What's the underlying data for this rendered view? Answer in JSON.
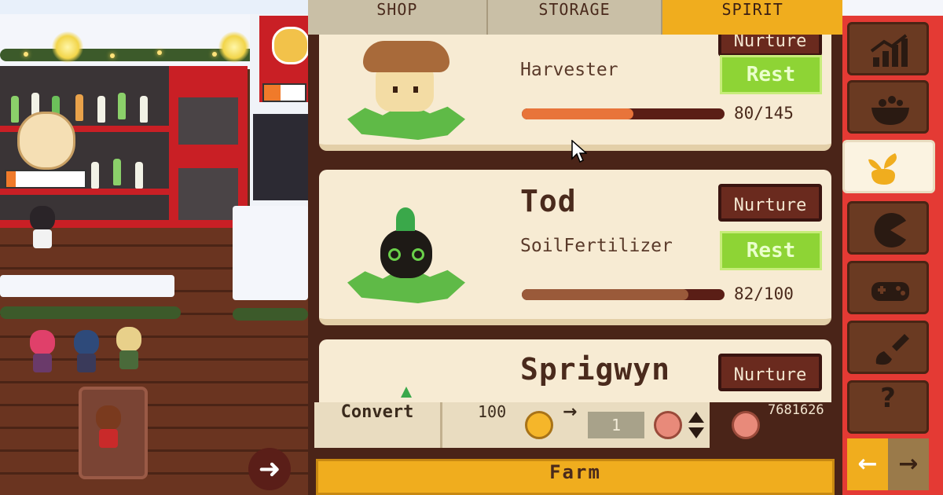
{
  "tabs": [
    {
      "label": "SHOP"
    },
    {
      "label": "STORAGE"
    },
    {
      "label": "SPIRIT"
    }
  ],
  "active_tab": "SPIRIT",
  "spirits": [
    {
      "name": "",
      "role": "Harvester",
      "nurture_label": "Nurture",
      "rest_label": "Rest",
      "progress_text": "80/145",
      "progress": 0.55,
      "bar_color": "#e8743a"
    },
    {
      "name": "Tod",
      "role": "SoilFertilizer",
      "nurture_label": "Nurture",
      "rest_label": "Rest",
      "progress_text": "82/100",
      "progress": 0.82,
      "bar_color": "#9a5a3a"
    },
    {
      "name": "Sprigwyn",
      "nurture_label": "Nurture"
    }
  ],
  "convert": {
    "label": "Convert",
    "coin_amount": "100",
    "arrow": "→",
    "quantity": "1",
    "balance": "7681626"
  },
  "farm_button": {
    "label": "Farm"
  },
  "side_menu": [
    {
      "icon": "stats-chart-icon"
    },
    {
      "icon": "food-bowl-icon"
    },
    {
      "icon": "spirit-sprout-icon",
      "active": true
    },
    {
      "icon": "pacman-icon"
    },
    {
      "icon": "gamepad-icon"
    },
    {
      "icon": "paint-brush-icon"
    },
    {
      "icon": "help-icon",
      "text": "?"
    }
  ],
  "nav": {
    "prev": "←",
    "next": "→"
  },
  "scene": {
    "next_arrow": "➜"
  },
  "colors": {
    "accent": "#f0ad1e",
    "card": "#f7ebd3",
    "panel_bg": "#4a2418",
    "rest_green": "#8ed435"
  }
}
